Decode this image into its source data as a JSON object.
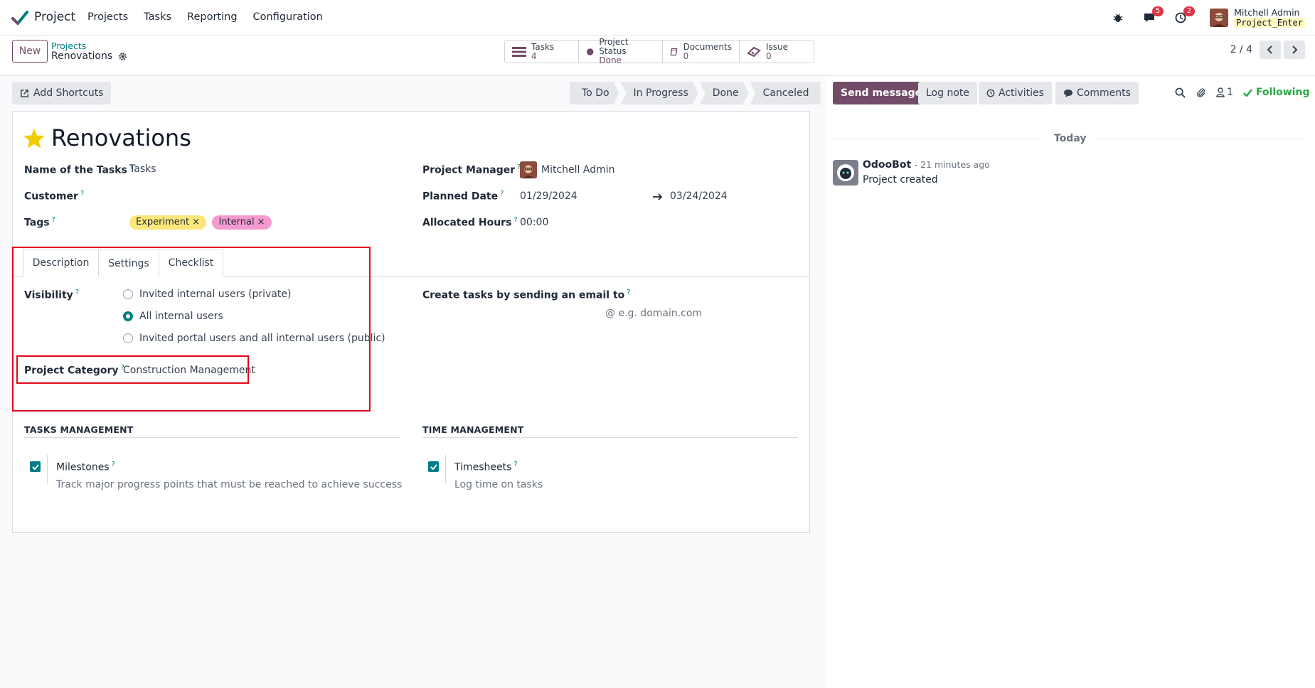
{
  "nav": {
    "app_name": "Project",
    "menu": [
      "Projects",
      "Tasks",
      "Reporting",
      "Configuration"
    ],
    "messages_badge": "5",
    "activities_badge": "2",
    "user_name": "Mitchell Admin",
    "db_name": "Project_Enter"
  },
  "control": {
    "new_label": "New",
    "breadcrumb_parent": "Projects",
    "breadcrumb_current": "Renovations",
    "smart_buttons": [
      {
        "label": "Tasks",
        "value": "4",
        "icon": "tasks-icon"
      },
      {
        "label": "Project Status",
        "value": "Done",
        "icon": "status-dot-icon"
      },
      {
        "label": "Documents",
        "value": "0",
        "icon": "book-icon"
      },
      {
        "label": "Issue",
        "value": "0",
        "icon": "ticket-icon"
      }
    ],
    "pager": "2 / 4"
  },
  "toolbar": {
    "shortcuts_label": "Add Shortcuts",
    "stages": [
      "To Do",
      "In Progress",
      "Done",
      "Canceled"
    ]
  },
  "form": {
    "title": "Renovations",
    "fields": {
      "tasks_name_label": "Name of the Tasks",
      "tasks_name_value": "Tasks",
      "customer_label": "Customer",
      "tags_label": "Tags",
      "manager_label": "Project Manager",
      "manager_value": "Mitchell Admin",
      "planned_label": "Planned Date",
      "planned_start": "01/29/2024",
      "planned_end": "03/24/2024",
      "alloc_label": "Allocated Hours",
      "alloc_value": "00:00"
    },
    "tags": [
      {
        "label": "Experiment",
        "color": "#fce77a"
      },
      {
        "label": "Internal",
        "color": "#f59ad1"
      }
    ],
    "tabs": [
      "Description",
      "Settings",
      "Checklist"
    ],
    "active_tab": "Settings",
    "settings": {
      "visibility_label": "Visibility",
      "visibility_options": [
        "Invited internal users (private)",
        "All internal users",
        "Invited portal users and all internal users (public)"
      ],
      "visibility_selected": "All internal users",
      "category_label": "Project Category",
      "category_value": "Construction Management",
      "email_label": "Create tasks by sending an email to",
      "email_placeholder": "e.g. domain.com"
    },
    "sections": {
      "tasks_title": "TASKS MANAGEMENT",
      "time_title": "TIME MANAGEMENT",
      "milestones_label": "Milestones",
      "milestones_desc": "Track major progress points that must be reached to achieve success",
      "timesheets_label": "Timesheets",
      "timesheets_desc": "Log time on tasks"
    }
  },
  "chatter": {
    "send_label": "Send message",
    "log_label": "Log note",
    "activities_label": "Activities",
    "comments_label": "Comments",
    "followers_count": "1",
    "following_label": "Following",
    "today_label": "Today",
    "message": {
      "author": "OdooBot",
      "time": "- 21 minutes ago",
      "body": "Project created"
    }
  },
  "colors": {
    "brand": "#714b67",
    "accent": "#017e84",
    "highlight": "#e3081b",
    "following": "#28a745"
  }
}
